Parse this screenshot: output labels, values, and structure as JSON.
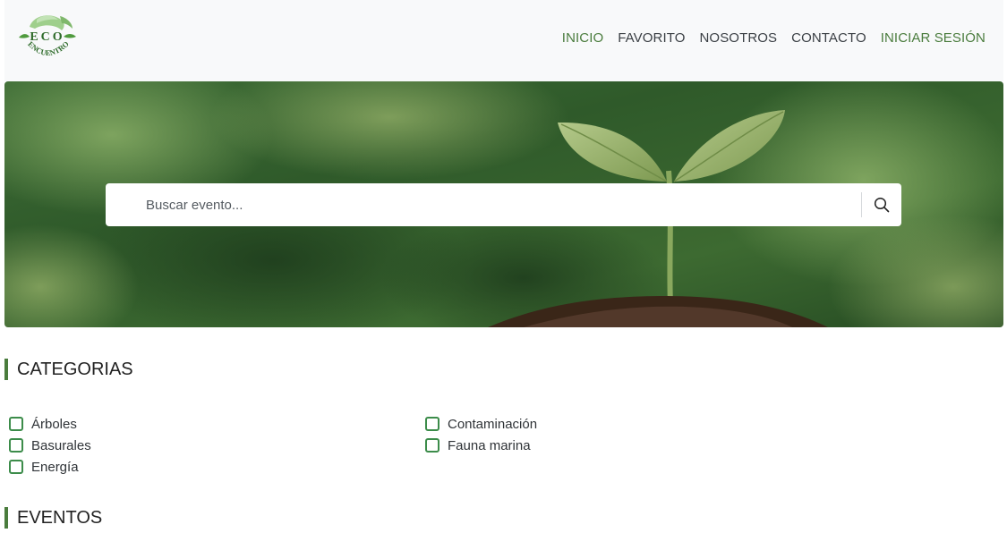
{
  "logo": {
    "text_top": "ECO",
    "text_bottom": "ENCUENTRO",
    "colors": {
      "leaf": "#8cc27a",
      "text": "#2e6b2a"
    }
  },
  "nav": {
    "items": [
      {
        "label": "INICIO",
        "accent": true
      },
      {
        "label": "FAVORITO",
        "accent": false
      },
      {
        "label": "NOSOTROS",
        "accent": false
      },
      {
        "label": "CONTACTO",
        "accent": false
      },
      {
        "label": "INICIAR SESIÓN",
        "accent": true
      }
    ]
  },
  "hero": {
    "search_placeholder": "Buscar evento...",
    "search_icon": "search-icon"
  },
  "categories": {
    "title": "CATEGORIAS",
    "left": [
      {
        "label": "Árboles",
        "checked": false
      },
      {
        "label": "Basurales",
        "checked": false
      },
      {
        "label": "Energía",
        "checked": false
      }
    ],
    "right": [
      {
        "label": "Contaminación",
        "checked": false
      },
      {
        "label": "Fauna marina",
        "checked": false
      }
    ]
  },
  "events": {
    "title": "EVENTOS"
  },
  "colors": {
    "accent": "#4a7c3d",
    "checkbox": "#3c8c4a",
    "navbar_bg": "#f8f9fa"
  }
}
